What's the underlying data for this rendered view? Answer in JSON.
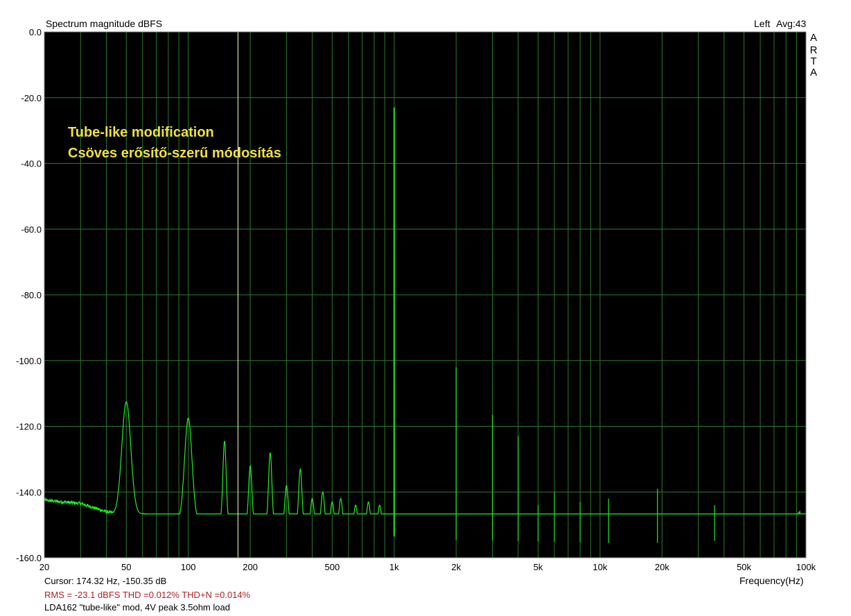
{
  "chart_data": {
    "type": "line",
    "title": "Spectrum magnitude dBFS",
    "channel": "Left",
    "averaging": "Avg:43",
    "xlabel": "Frequency(Hz)",
    "ylabel": "",
    "x_scale": "log",
    "xlim": [
      20,
      100000
    ],
    "ylim": [
      -160,
      0
    ],
    "x_ticks": [
      {
        "value": 20,
        "label": "20"
      },
      {
        "value": 50,
        "label": "50"
      },
      {
        "value": 100,
        "label": "100"
      },
      {
        "value": 200,
        "label": "200"
      },
      {
        "value": 500,
        "label": "500"
      },
      {
        "value": 1000,
        "label": "1k"
      },
      {
        "value": 2000,
        "label": "2k"
      },
      {
        "value": 5000,
        "label": "5k"
      },
      {
        "value": 10000,
        "label": "10k"
      },
      {
        "value": 20000,
        "label": "20k"
      },
      {
        "value": 50000,
        "label": "50k"
      },
      {
        "value": 100000,
        "label": "100k"
      }
    ],
    "y_ticks": [
      {
        "value": 0,
        "label": "0.0"
      },
      {
        "value": -20,
        "label": "-20.0"
      },
      {
        "value": -40,
        "label": "-40.0"
      },
      {
        "value": -60,
        "label": "-60.0"
      },
      {
        "value": -80,
        "label": "-80.0"
      },
      {
        "value": -100,
        "label": "-100.0"
      },
      {
        "value": -120,
        "label": "-120.0"
      },
      {
        "value": -140,
        "label": "-140.0"
      },
      {
        "value": -160,
        "label": "-160.0"
      }
    ],
    "grid": true,
    "cursor_x": 174.32,
    "annotations": [
      "Tube-like modification",
      "Csöves erősítő-szerű módosítás"
    ],
    "series": [
      {
        "color": "#22ee22",
        "noise_floor": [
          [
            20,
            -142.5
          ],
          [
            30,
            -143.5
          ],
          [
            40,
            -146
          ],
          [
            45,
            -146.5
          ],
          [
            60,
            -147
          ],
          [
            80,
            -147.5
          ],
          [
            100,
            -149
          ],
          [
            200,
            -150
          ],
          [
            500,
            -151
          ],
          [
            1000,
            -151.5
          ],
          [
            2000,
            -152.5
          ],
          [
            5000,
            -153
          ],
          [
            10000,
            -153.5
          ],
          [
            20000,
            -153.5
          ],
          [
            50000,
            -152.5
          ],
          [
            80000,
            -150.5
          ],
          [
            95000,
            -148
          ],
          [
            100000,
            -153
          ]
        ],
        "peaks": [
          {
            "f": 50,
            "db": -112.5,
            "type": "broad"
          },
          {
            "f": 100,
            "db": -117.5,
            "type": "broad"
          },
          {
            "f": 150,
            "db": -124.5,
            "type": "broad"
          },
          {
            "f": 200,
            "db": -132,
            "type": "broad"
          },
          {
            "f": 250,
            "db": -128,
            "type": "broad"
          },
          {
            "f": 300,
            "db": -138,
            "type": "broad"
          },
          {
            "f": 350,
            "db": -133,
            "type": "broad"
          },
          {
            "f": 400,
            "db": -142,
            "type": "broad"
          },
          {
            "f": 450,
            "db": -140,
            "type": "broad"
          },
          {
            "f": 500,
            "db": -143,
            "type": "broad"
          },
          {
            "f": 550,
            "db": -142,
            "type": "broad"
          },
          {
            "f": 650,
            "db": -144,
            "type": "broad"
          },
          {
            "f": 750,
            "db": -143,
            "type": "broad"
          },
          {
            "f": 850,
            "db": -144,
            "type": "broad"
          },
          {
            "f": 1000,
            "db": -23,
            "type": "spike"
          },
          {
            "f": 2000,
            "db": -102,
            "type": "spike"
          },
          {
            "f": 3000,
            "db": -116.5,
            "type": "spike"
          },
          {
            "f": 4000,
            "db": -123,
            "type": "spike"
          },
          {
            "f": 5000,
            "db": -144,
            "type": "spike"
          },
          {
            "f": 6000,
            "db": -140,
            "type": "spike"
          },
          {
            "f": 8000,
            "db": -143,
            "type": "spike"
          },
          {
            "f": 11000,
            "db": -142,
            "type": "spike"
          },
          {
            "f": 19000,
            "db": -139,
            "type": "spike"
          },
          {
            "f": 36000,
            "db": -144,
            "type": "spike"
          }
        ]
      }
    ]
  },
  "cursor_readout": "Cursor: 174.32 Hz, -150.35 dB",
  "stats_line": "RMS =  -23.1 dBFS   THD =0.012%   THD+N =0.014%",
  "description_line": "LDA162 \"tube-like\" mod, 4V peak 3.5ohm load",
  "watermark": [
    "A",
    "R",
    "T",
    "A"
  ],
  "colors": {
    "plot_background": "#000000",
    "grid": "#2d7a2d",
    "trace": "#22ee22",
    "annotation_text": "#f0e040",
    "cursor_line": "#ffffcc",
    "stats_text": "#b22222"
  }
}
